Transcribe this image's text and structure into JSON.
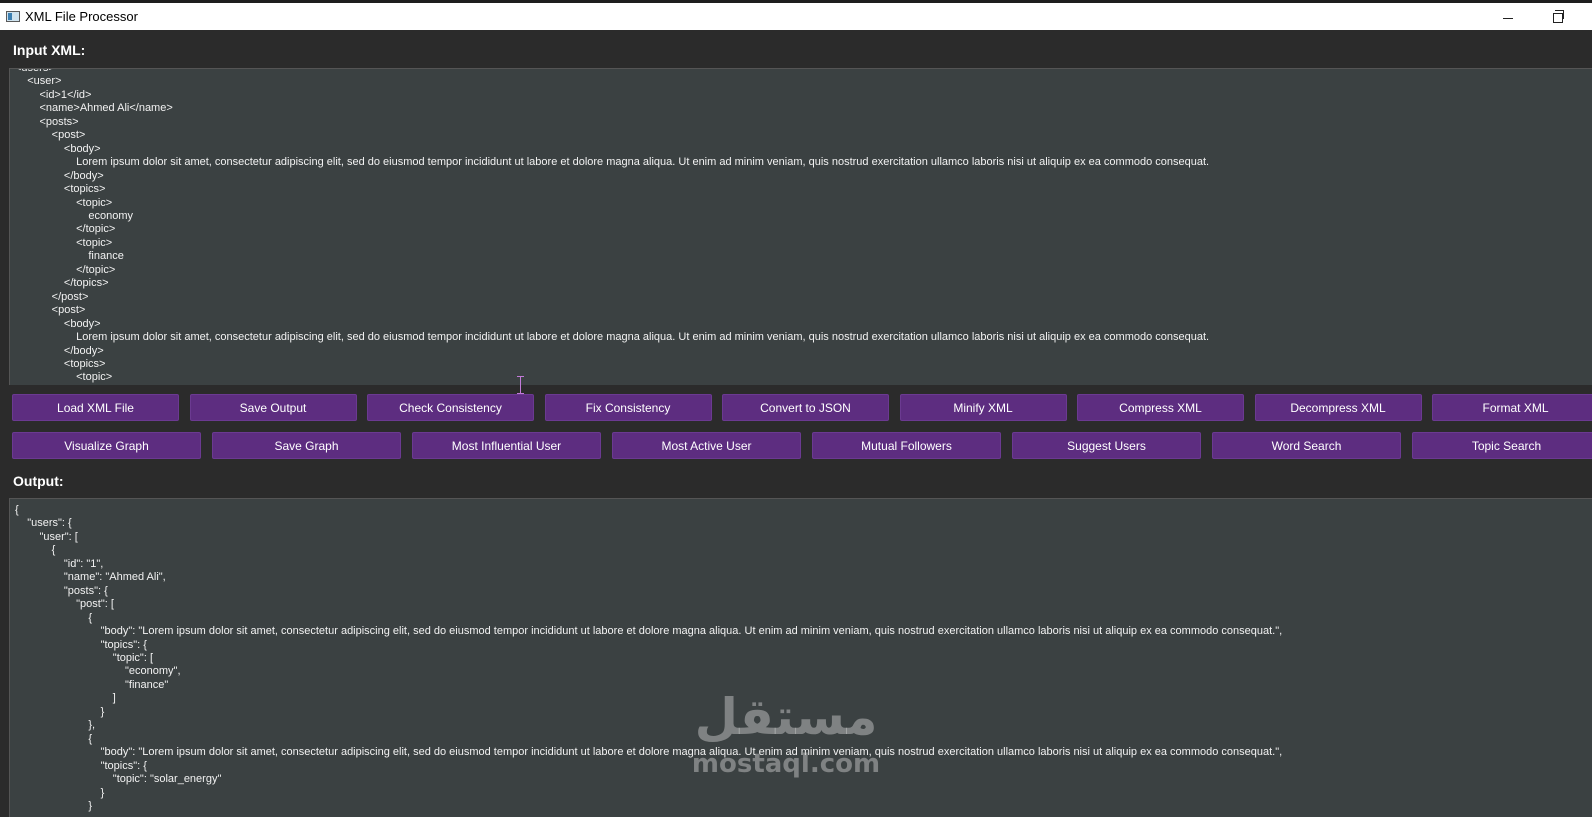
{
  "window": {
    "title": "XML File Processor",
    "minimize_glyph": "—",
    "maximize_glyph": "❐"
  },
  "input": {
    "label": "Input XML:",
    "text": "<users>\n    <user>\n        <id>1</id>\n        <name>Ahmed Ali</name>\n        <posts>\n            <post>\n                <body>\n                    Lorem ipsum dolor sit amet, consectetur adipiscing elit, sed do eiusmod tempor incididunt ut labore et dolore magna aliqua. Ut enim ad minim veniam, quis nostrud exercitation ullamco laboris nisi ut aliquip ex ea commodo consequat.\n                </body>\n                <topics>\n                    <topic>\n                        economy\n                    </topic>\n                    <topic>\n                        finance\n                    </topic>\n                </topics>\n            </post>\n            <post>\n                <body>\n                    Lorem ipsum dolor sit amet, consectetur adipiscing elit, sed do eiusmod tempor incididunt ut labore et dolore magna aliqua. Ut enim ad minim veniam, quis nostrud exercitation ullamco laboris nisi ut aliquip ex ea commodo consequat.\n                </body>\n                <topics>\n                    <topic>"
  },
  "buttons_row1": [
    "Load XML File",
    "Save Output",
    "Check Consistency",
    "Fix Consistency",
    "Convert to JSON",
    "Minify XML",
    "Compress XML",
    "Decompress XML",
    "Format XML"
  ],
  "buttons_row2": [
    "Visualize Graph",
    "Save Graph",
    "Most Influential User",
    "Most Active User",
    "Mutual Followers",
    "Suggest Users",
    "Word Search",
    "Topic Search"
  ],
  "output": {
    "label": "Output:",
    "text": "{\n    \"users\": {\n        \"user\": [\n            {\n                \"id\": \"1\",\n                \"name\": \"Ahmed Ali\",\n                \"posts\": {\n                    \"post\": [\n                        {\n                            \"body\": \"Lorem ipsum dolor sit amet, consectetur adipiscing elit, sed do eiusmod tempor incididunt ut labore et dolore magna aliqua. Ut enim ad minim veniam, quis nostrud exercitation ullamco laboris nisi ut aliquip ex ea commodo consequat.\",\n                            \"topics\": {\n                                \"topic\": [\n                                    \"economy\",\n                                    \"finance\"\n                                ]\n                            }\n                        },\n                        {\n                            \"body\": \"Lorem ipsum dolor sit amet, consectetur adipiscing elit, sed do eiusmod tempor incididunt ut labore et dolore magna aliqua. Ut enim ad minim veniam, quis nostrud exercitation ullamco laboris nisi ut aliquip ex ea commodo consequat.\",\n                            \"topics\": {\n                                \"topic\": \"solar_energy\"\n                            }\n                        }"
  },
  "watermark": {
    "arabic": "مستقل",
    "latin": "mostaql.com"
  },
  "colors": {
    "background": "#2b2b2b",
    "editor_background": "#3b4142",
    "button": "#5d2d80",
    "text": "#f2f2f2"
  }
}
